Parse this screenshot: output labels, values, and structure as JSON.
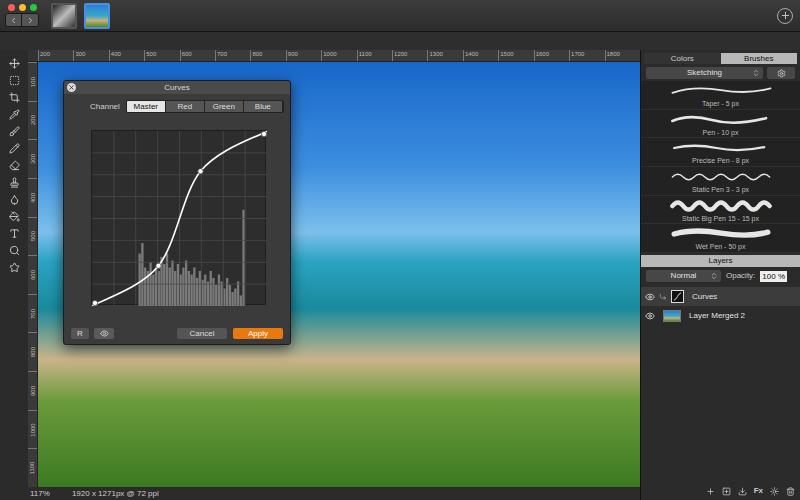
{
  "documents": [
    {
      "selected": false
    },
    {
      "selected": true
    }
  ],
  "ruler": {
    "top": [
      "200",
      "300",
      "400",
      "500",
      "600",
      "700",
      "800",
      "900",
      "1000",
      "1100",
      "1200",
      "1300",
      "1400",
      "1500",
      "1600",
      "1700",
      "1800"
    ],
    "left": [
      "100",
      "200",
      "300",
      "400",
      "500",
      "600",
      "700",
      "800",
      "900",
      "1000",
      "1100"
    ]
  },
  "curves": {
    "title": "Curves",
    "channel_label": "Channel",
    "channels": [
      {
        "label": "Master",
        "selected": true
      },
      {
        "label": "Red",
        "selected": false
      },
      {
        "label": "Green",
        "selected": false
      },
      {
        "label": "Blue",
        "selected": false
      }
    ],
    "curve_points": [
      [
        0,
        0
      ],
      [
        0.38,
        0.23
      ],
      [
        0.62,
        0.77
      ],
      [
        1,
        1
      ]
    ],
    "histogram": [
      0,
      0,
      0,
      0,
      0,
      0,
      0,
      0,
      0,
      0,
      0,
      0,
      0,
      0,
      0,
      0,
      0,
      0.3,
      0.36,
      0.22,
      0.2,
      0.25,
      0.18,
      0.22,
      0.2,
      0.28,
      0.24,
      0.3,
      0.22,
      0.26,
      0.2,
      0.24,
      0.18,
      0.22,
      0.26,
      0.2,
      0.18,
      0.22,
      0.16,
      0.2,
      0.15,
      0.18,
      0.14,
      0.2,
      0.16,
      0.12,
      0.18,
      0.14,
      0.1,
      0.16,
      0.12,
      0.08,
      0.1,
      0.14,
      0.06,
      0.55,
      0,
      0,
      0,
      0,
      0,
      0,
      0,
      0
    ],
    "reset": "R",
    "preview": true,
    "cancel": "Cancel",
    "apply": "Apply"
  },
  "panel_tabs": [
    {
      "label": "Colors",
      "selected": false
    },
    {
      "label": "Brushes",
      "selected": true
    }
  ],
  "brushes": {
    "set": "Sketching",
    "items": [
      {
        "name": "Taper - 5 px",
        "kind": "taper"
      },
      {
        "name": "Pen - 10 px",
        "kind": "pen"
      },
      {
        "name": "Precise Pen - 8 px",
        "kind": "precise"
      },
      {
        "name": "Static Pen 3 - 3 px",
        "kind": "static"
      },
      {
        "name": "Static Big Pen 15 - 15 px",
        "kind": "big"
      },
      {
        "name": "Wet Pen - 50 px",
        "kind": "wet"
      }
    ]
  },
  "layers": {
    "title": "Layers",
    "blend_mode": "Normal",
    "opacity_label": "Opacity:",
    "opacity": "100 %",
    "items": [
      {
        "name": "Curves",
        "visible": true,
        "selected": true,
        "kind": "adjustment"
      },
      {
        "name": "Layer Merged 2",
        "visible": true,
        "selected": false,
        "kind": "image"
      }
    ],
    "fx_label": "Fx"
  },
  "status_bar": {
    "zoom": "117%",
    "size": "1920 x 1271px @ 72 ppi"
  }
}
